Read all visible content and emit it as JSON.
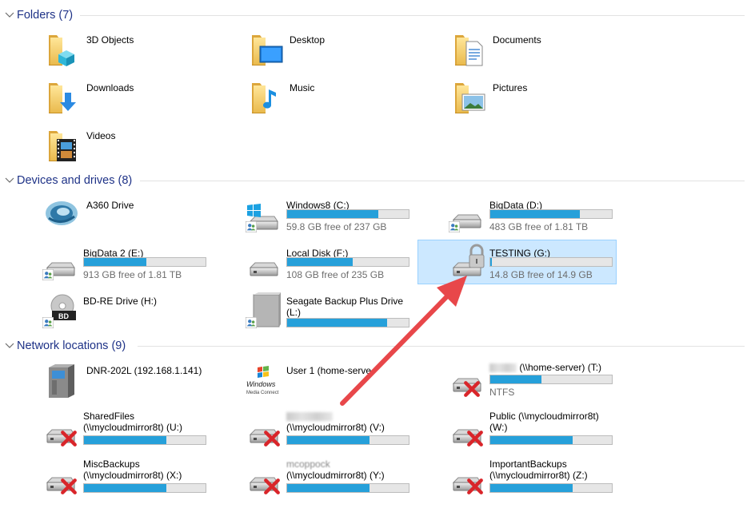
{
  "groups": {
    "folders": "Folders (7)",
    "devices": "Devices and drives (8)",
    "network": "Network locations (9)"
  },
  "folders": [
    {
      "label": "3D Objects",
      "icon": "3d-objects-folder-icon"
    },
    {
      "label": "Desktop",
      "icon": "desktop-folder-icon"
    },
    {
      "label": "Documents",
      "icon": "documents-folder-icon"
    },
    {
      "label": "Downloads",
      "icon": "downloads-folder-icon"
    },
    {
      "label": "Music",
      "icon": "music-folder-icon"
    },
    {
      "label": "Pictures",
      "icon": "pictures-folder-icon"
    },
    {
      "label": "Videos",
      "icon": "videos-folder-icon"
    }
  ],
  "drives": [
    {
      "label": "A360 Drive",
      "icon": "a360-drive-icon"
    },
    {
      "label": "Windows8 (C:)",
      "free": "59.8 GB free of 237 GB",
      "fill": 0.75
    },
    {
      "label": "BigData (D:)",
      "free": "483 GB free of 1.81 TB",
      "fill": 0.74
    },
    {
      "label": "BigData 2 (E:)",
      "free": "913 GB free of 1.81 TB",
      "fill": 0.51
    },
    {
      "label": "Local Disk (F:)",
      "free": "108 GB free of 235 GB",
      "fill": 0.54
    },
    {
      "label": "TESTING (G:)",
      "free": "14.8 GB free of 14.9 GB",
      "fill": 0.01
    },
    {
      "label": "BD-RE Drive (H:)"
    },
    {
      "label": "Seagate Backup Plus Drive",
      "label2": "(L:)",
      "fill": 0.82
    }
  ],
  "network": [
    {
      "label": "DNR-202L (192.168.1.141)"
    },
    {
      "label": "User 1 (home-serve",
      "logo_text1": "Windows",
      "logo_text2": "Media Connect"
    },
    {
      "label": "(\\\\home-server) (T:)",
      "free": "NTFS",
      "fill": 0.42
    },
    {
      "label": "SharedFiles",
      "label2": "(\\\\mycloudmirror8t) (U:)",
      "fill": 0.68
    },
    {
      "label": "",
      "label2": "(\\\\mycloudmirror8t) (V:)",
      "fill": 0.68
    },
    {
      "label": "Public (\\\\mycloudmirror8t)",
      "label2": "(W:)",
      "fill": 0.68
    },
    {
      "label": "MiscBackups",
      "label2": "(\\\\mycloudmirror8t) (X:)",
      "fill": 0.68
    },
    {
      "label": "mcoppock",
      "label2": "(\\\\mycloudmirror8t) (Y:)",
      "fill": 0.68
    },
    {
      "label": "ImportantBackups",
      "label2": "(\\\\mycloudmirror8t) (Z:)",
      "fill": 0.68
    }
  ],
  "bd_label": "BD",
  "colors": {
    "accent": "#26a0da",
    "header": "#1e3287",
    "selection": "#cce8ff",
    "arrow": "#e8474a"
  }
}
